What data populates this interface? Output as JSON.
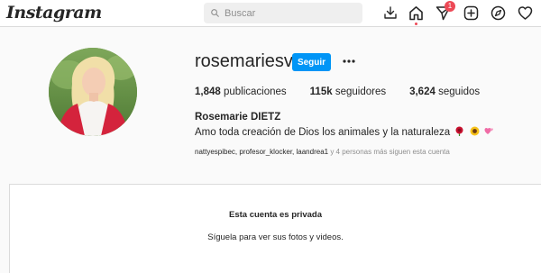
{
  "header": {
    "logo_text": "Instagram",
    "search_placeholder": "Buscar",
    "notification_count": "1",
    "icons": [
      "download-icon",
      "home-icon",
      "send-icon",
      "new-post-icon",
      "explore-icon",
      "heart-icon"
    ]
  },
  "profile": {
    "username": "rosemariesv",
    "follow_label": "Seguir",
    "more_label": "•••",
    "stats": {
      "posts_count": "1,848",
      "posts_label": "publicaciones",
      "followers_count": "115k",
      "followers_label": "seguidores",
      "following_count": "3,624",
      "following_label": "seguidos"
    },
    "full_name": "Rosemarie DIETZ",
    "bio": "Amo toda creación de Dios los animales y la naturaleza",
    "bio_emojis": [
      "rose",
      "sunflower",
      "hearts"
    ],
    "followed_by_names": "nattyespibec, profesor_klocker, laandrea1",
    "followed_by_suffix": " y 4 personas más siguen esta cuenta"
  },
  "private": {
    "title": "Esta cuenta es privada",
    "subtitle": "Síguela para ver sus fotos y videos."
  },
  "colors": {
    "accent": "#0095f6",
    "badge": "#ed4956",
    "border": "#dbdbdb",
    "background": "#fafafa"
  }
}
